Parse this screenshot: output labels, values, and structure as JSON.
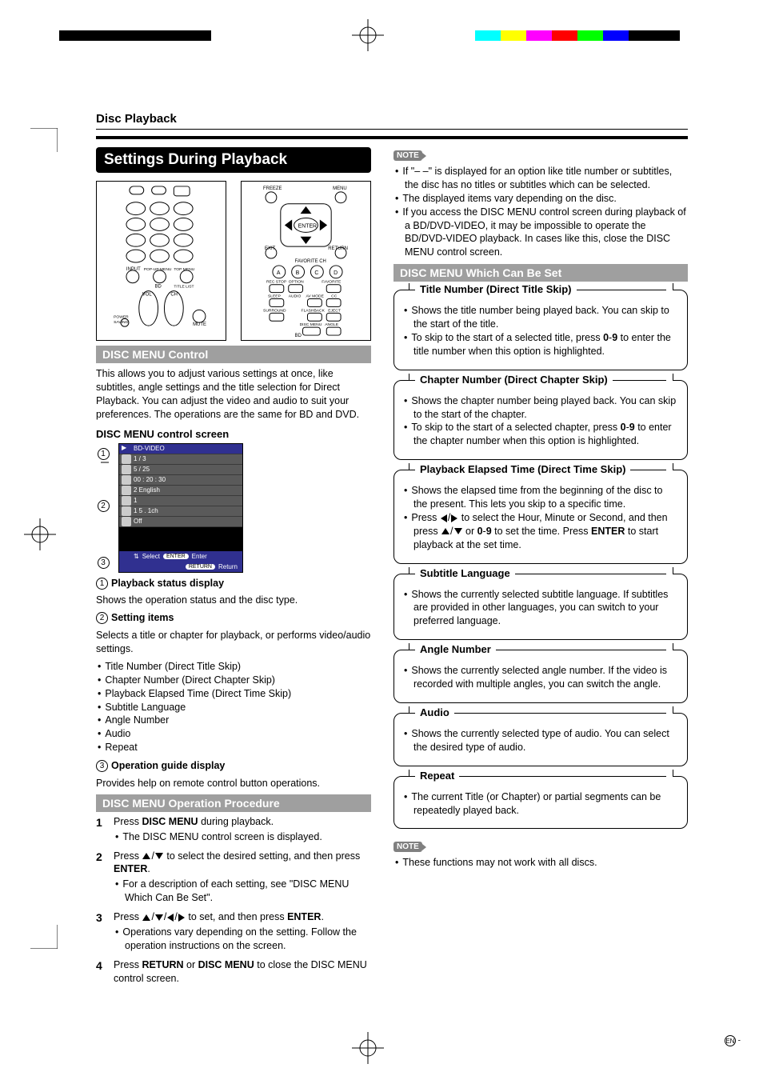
{
  "header": {
    "breadcrumb": "Disc Playback"
  },
  "band_main": "Settings During Playback",
  "left": {
    "sub_menu_control": "DISC MENU Control",
    "menu_control_para": "This allows you to adjust various settings at once, like subtitles, angle settings and the title selection for Direct Playback. You can adjust the video and audio to suit your preferences. The operations are the same for BD and DVD.",
    "screen_heading": "DISC MENU control screen",
    "screen": {
      "title": "BD-VIDEO",
      "rows": [
        "1 / 3",
        "5 / 25",
        "00 : 20 : 30",
        "2 English",
        "1",
        "1   5 . 1ch",
        "Off"
      ],
      "bot_select": "Select",
      "bot_enter": "Enter",
      "bot_return": "Return",
      "enter_pill": "ENTER",
      "return_pill": "RETURN"
    },
    "item1_title": "Playback status display",
    "item1_body": "Shows the operation status and the disc type.",
    "item2_title": "Setting items",
    "item2_body": "Selects a title or chapter for playback, or performs video/audio settings.",
    "item2_list": [
      "Title Number (Direct Title Skip)",
      "Chapter Number (Direct Chapter Skip)",
      "Playback Elapsed Time (Direct Time Skip)",
      "Subtitle Language",
      "Angle Number",
      "Audio",
      "Repeat"
    ],
    "item3_title": "Operation guide display",
    "item3_body": "Provides help on remote control button operations.",
    "sub_op_proc": "DISC MENU Operation Procedure",
    "steps": {
      "s1a": "Press ",
      "s1b": "DISC MENU",
      "s1c": " during playback.",
      "s1sub": "The DISC MENU control screen is displayed.",
      "s2a": "Press ",
      "s2b": " to select the desired setting, and then press ",
      "s2c": "ENTER",
      "s2d": ".",
      "s2sub": "For a description of each setting, see \"DISC MENU Which Can Be Set\".",
      "s3a": "Press ",
      "s3b": " to set, and then press ",
      "s3c": "ENTER",
      "s3d": ".",
      "s3sub": "Operations vary depending on the setting. Follow the operation instructions on the screen.",
      "s4a": "Press ",
      "s4b": "RETURN",
      "s4c": " or ",
      "s4d": "DISC MENU",
      "s4e": " to close the DISC MENU control screen."
    }
  },
  "right": {
    "note": "NOTE",
    "notes1": [
      "If \"– –\" is displayed for an option like title number or subtitles, the disc has no titles or subtitles which can be selected.",
      "The displayed items vary depending on the disc.",
      "If you access the DISC MENU control screen during playback of a BD/DVD-VIDEO, it may be impossible to operate the BD/DVD-VIDEO playback. In cases like this, close the DISC MENU control screen."
    ],
    "sub_set": "DISC MENU Which Can Be Set",
    "opts": [
      {
        "title": "Title Number (Direct Title Skip)",
        "items": [
          "Shows the title number being played back. You can skip to the start of the title.",
          "To skip to the start of a selected title, press 0-9 to enter the title number when this option is highlighted."
        ]
      },
      {
        "title": "Chapter Number (Direct Chapter Skip)",
        "items": [
          "Shows the chapter number being played back. You can skip to the start of the chapter.",
          "To skip to the start of a selected chapter, press 0-9 to enter the chapter number when this option is highlighted."
        ]
      },
      {
        "title": "Playback Elapsed Time (Direct Time Skip)",
        "items": [
          "Shows the elapsed time from the beginning of the disc to the present. This lets you skip to a specific time.",
          "Press ◀/▶ to select the Hour, Minute or  Second, and then press ▲/▼ or 0-9 to set the time. Press ENTER to start playback at the set time."
        ]
      },
      {
        "title": "Subtitle Language",
        "items": [
          "Shows the currently selected subtitle language. If subtitles are provided in other languages, you can switch to your preferred language."
        ]
      },
      {
        "title": "Angle Number",
        "items": [
          "Shows the currently selected angle number. If the video is recorded with multiple angles, you can switch the angle."
        ]
      },
      {
        "title": "Audio",
        "items": [
          "Shows the currently selected type of audio. You can select the desired type of audio."
        ]
      },
      {
        "title": "Repeat",
        "items": [
          "The current Title (or Chapter) or partial segments can be repeatedly played back."
        ]
      }
    ],
    "notes2": [
      "These functions may not work with all discs."
    ]
  },
  "footer": {
    "locale": "EN",
    "dash": " -"
  }
}
